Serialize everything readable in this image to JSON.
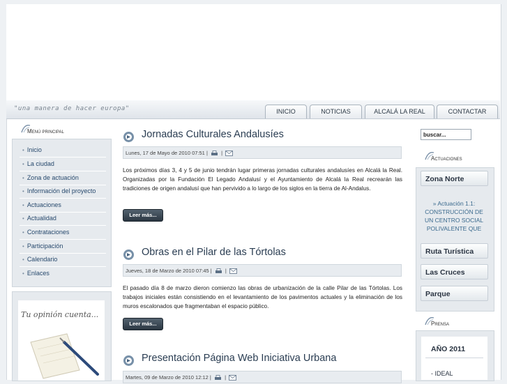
{
  "header": {
    "slogan": "\"una manera de hacer europa\""
  },
  "nav": {
    "tabs": [
      {
        "label": "INICIO"
      },
      {
        "label": "NOTICIAS"
      },
      {
        "label": "ALCALÁ LA REAL"
      },
      {
        "label": "CONTACTAR"
      }
    ]
  },
  "sidebar": {
    "title": "Menú principal",
    "items": [
      {
        "label": "Inicio"
      },
      {
        "label": "La ciudad"
      },
      {
        "label": "Zona de actuación"
      },
      {
        "label": "Información del proyecto"
      },
      {
        "label": "Actuaciones"
      },
      {
        "label": "Actualidad"
      },
      {
        "label": "Contrataciones"
      },
      {
        "label": "Participación"
      },
      {
        "label": "Calendario"
      },
      {
        "label": "Enlaces"
      }
    ],
    "opinion_text": "Tu opinión cuenta..."
  },
  "articles": [
    {
      "title": "Jornadas Culturales Andalusíes",
      "date": "Lunes, 17 de Mayo de 2010 07:51",
      "body": "Los próximos días 3, 4 y 5 de junio tendrán lugar primeras jornadas culturales andalusíes en Alcalá la Real. Organizadas por la Fundación El Legado Andalusí y el Ayuntamiento de Alcalá la Real recrearán las tradiciones de origen andalusí que han pervivido a lo largo de los siglos en la tierra de Al-Andalus.",
      "readmore": "Leer más..."
    },
    {
      "title": "Obras en el Pilar de las Tórtolas",
      "date": "Jueves, 18 de Marzo de 2010 07:45",
      "body": "El pasado día 8 de marzo dieron comienzo las obras de urbanización de la calle Pilar de las Tórtolas. Los trabajos iniciales están consistiendo en el levantamiento de los pavimentos actuales y la eliminación de los muros escalonados que fragmentaban el espacio público.",
      "readmore": "Leer más..."
    },
    {
      "title": "Presentación Página Web Iniciativa Urbana",
      "date": "Martes, 09 de Marzo de 2010 12:12",
      "body": "",
      "readmore": ""
    }
  ],
  "meta_sep": "|",
  "right": {
    "search_value": "buscar...",
    "actuaciones_title": "Actuaciones",
    "zona_norte": "Zona Norte",
    "actuacion_text": "» Actuación 1.1: CONSTRUCCIÓN DE UN CENTRO SOCIAL POLIVALENTE QUE",
    "buttons": [
      {
        "label": "Ruta Turística"
      },
      {
        "label": "Las Cruces"
      },
      {
        "label": "Parque"
      }
    ],
    "prensa_title": "Prensa",
    "prensa_year": "AÑO 2011",
    "prensa_item": "- IDEAL"
  },
  "colors": {
    "accent": "#27496d",
    "button_dark": "#2b3742"
  }
}
